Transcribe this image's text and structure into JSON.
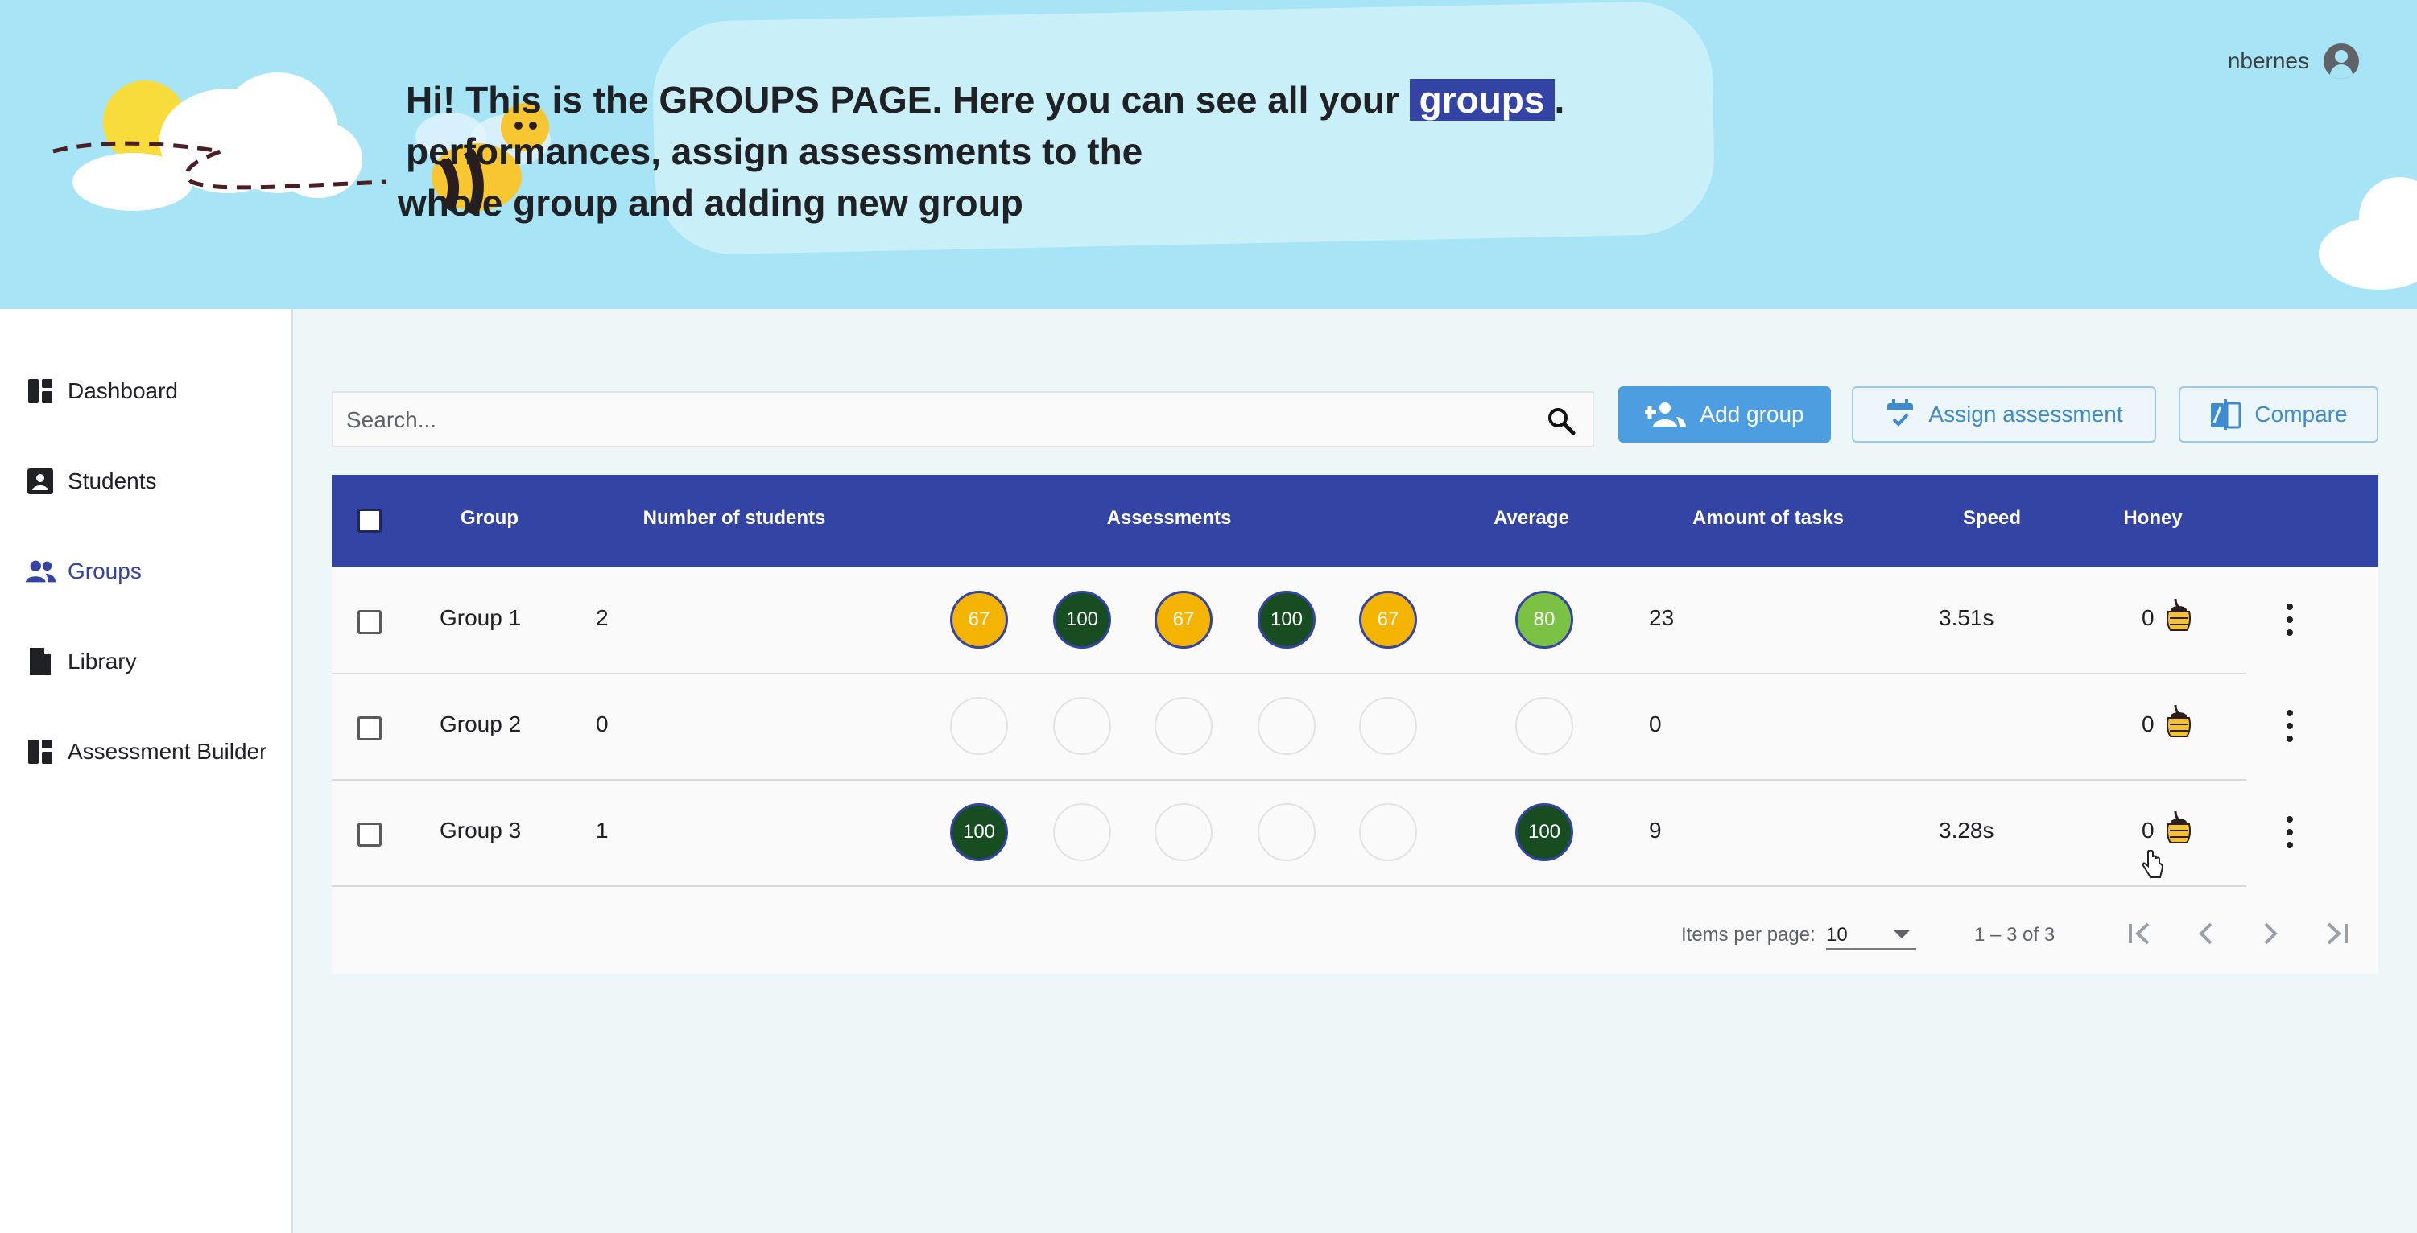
{
  "header": {
    "line1_prefix": "Hi! This is the  GROUPS PAGE.  Here you can see all your ",
    "highlight": "groups",
    "line1_suffix": ".",
    "line2": "performances, assign assessments to the",
    "line3": "whole group and adding new group",
    "username": "nbernes"
  },
  "sidebar": {
    "items": [
      {
        "label": "Dashboard",
        "icon": "dashboard-icon"
      },
      {
        "label": "Students",
        "icon": "student-card-icon"
      },
      {
        "label": "Groups",
        "icon": "groups-icon",
        "active": true
      },
      {
        "label": "Library",
        "icon": "document-icon"
      },
      {
        "label": "Assessment Builder",
        "icon": "builder-icon"
      }
    ]
  },
  "toolbar": {
    "search_placeholder": "Search...",
    "add_group_label": "Add group",
    "assign_assessment_label": "Assign assessment",
    "compare_label": "Compare"
  },
  "table": {
    "headers": {
      "group": "Group",
      "number_of_students": "Number of students",
      "assessments": "Assessments",
      "average": "Average",
      "amount_of_tasks": "Amount of tasks",
      "speed": "Speed",
      "honey": "Honey"
    },
    "rows": [
      {
        "group": "Group 1",
        "students": "2",
        "assessments": [
          "67",
          "100",
          "67",
          "100",
          "67"
        ],
        "assessment_colors": [
          "yellow",
          "dark",
          "yellow",
          "dark",
          "yellow"
        ],
        "average": "80",
        "average_color": "green",
        "tasks": "23",
        "speed": "3.51s",
        "honey": "0"
      },
      {
        "group": "Group 2",
        "students": "0",
        "assessments": [
          "",
          "",
          "",
          "",
          ""
        ],
        "assessment_colors": [
          "empty",
          "empty",
          "empty",
          "empty",
          "empty"
        ],
        "average": "",
        "average_color": "empty",
        "tasks": "0",
        "speed": "",
        "honey": "0"
      },
      {
        "group": "Group 3",
        "students": "1",
        "assessments": [
          "100",
          "",
          "",
          "",
          ""
        ],
        "assessment_colors": [
          "dark",
          "empty",
          "empty",
          "empty",
          "empty"
        ],
        "average": "100",
        "average_color": "dark",
        "tasks": "9",
        "speed": "3.28s",
        "honey": "0"
      }
    ]
  },
  "paginator": {
    "items_per_page_label": "Items per page:",
    "items_per_page_value": "10",
    "range": "1 – 3 of 3"
  },
  "colors": {
    "header_bg": "#a7e4f5",
    "table_header": "#3444a4",
    "primary_button": "#4d9ee0",
    "score_yellow": "#f4b400",
    "score_dark": "#174d21",
    "score_green": "#7bc143"
  }
}
